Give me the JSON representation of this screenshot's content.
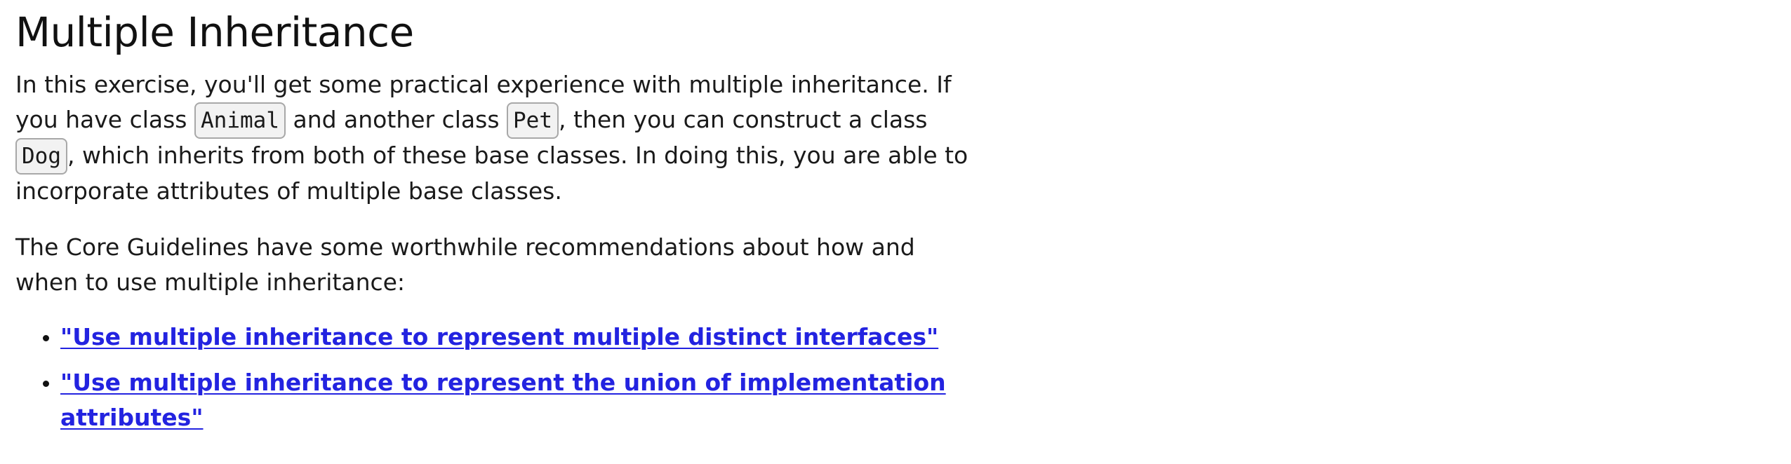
{
  "title": "Multiple Inheritance",
  "paragraph1": {
    "t1": "In this exercise, you'll get some practical experience with multiple inheritance. If you have class ",
    "code1": "Animal",
    "t2": " and another class ",
    "code2": "Pet",
    "t3": ", then you can construct a class ",
    "code3": "Dog",
    "t4": ", which inherits from both of these base classes. In doing this, you are able to incorporate attributes of multiple base classes."
  },
  "paragraph2": "The Core Guidelines have some worthwhile recommendations about how and when to use multiple inheritance:",
  "links": [
    {
      "label": "\"Use multiple inheritance to represent multiple distinct interfaces\""
    },
    {
      "label": "\"Use multiple inheritance to represent the union of implementation attributes\""
    }
  ],
  "colors": {
    "link": "#2323e0",
    "text": "#1a1a1a",
    "code_bg": "#f2f2f2",
    "code_border": "#a8a8a8"
  }
}
